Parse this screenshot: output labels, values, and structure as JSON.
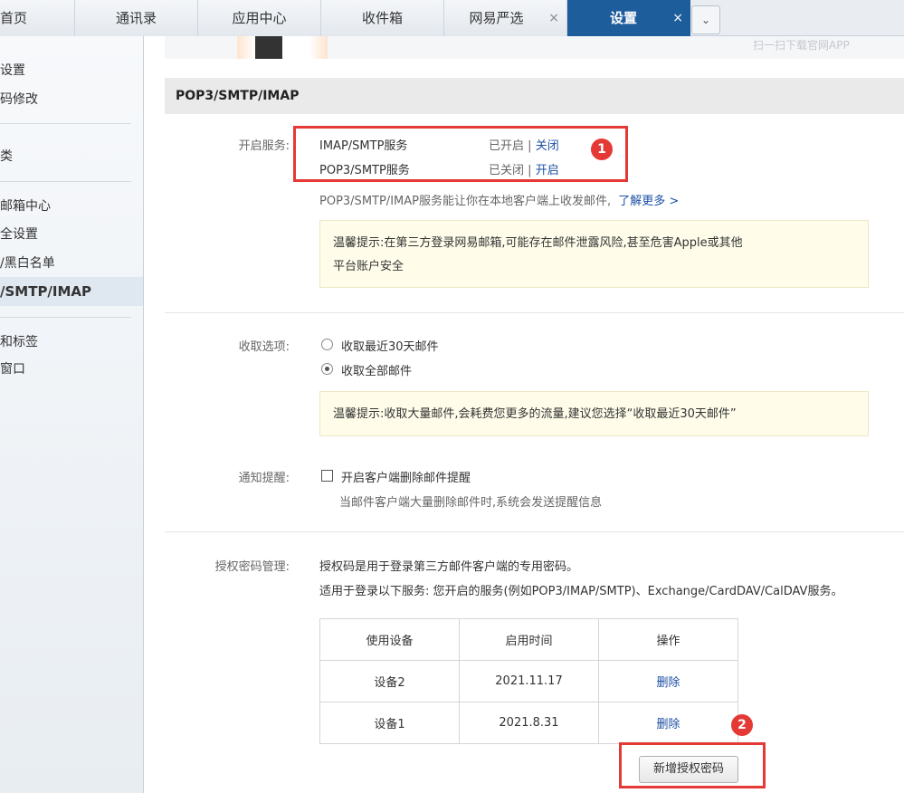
{
  "tabs": [
    {
      "label": "首页"
    },
    {
      "label": "通讯录"
    },
    {
      "label": "应用中心"
    },
    {
      "label": "收件箱"
    },
    {
      "label": "网易严选",
      "close": "×"
    },
    {
      "label": "设置",
      "close": "×"
    }
  ],
  "tab_dropdown": "⌄",
  "sidebar": {
    "items": [
      {
        "label": "设置"
      },
      {
        "label": "码修改"
      },
      {
        "label": "类"
      },
      {
        "label": "邮箱中心"
      },
      {
        "label": "全设置"
      },
      {
        "label": "/黑白名单"
      },
      {
        "label": "/SMTP/IMAP"
      },
      {
        "label": "和标签"
      },
      {
        "label": "窗口"
      }
    ]
  },
  "top_banner": {
    "qr_text": "扫一扫下载官网APP"
  },
  "section_title": "POP3/SMTP/IMAP",
  "services": {
    "label": "开启服务:",
    "rows": [
      {
        "name": "IMAP/SMTP服务",
        "status": "已开启",
        "sep": "|",
        "action": "关闭"
      },
      {
        "name": "POP3/SMTP服务",
        "status": "已关闭",
        "sep": "|",
        "action": "开启"
      }
    ],
    "desc": "POP3/SMTP/IMAP服务能让你在本地客户端上收发邮件,",
    "learn_more": "了解更多 >",
    "tip_line1": "温馨提示:在第三方登录网易邮箱,可能存在邮件泄露风险,甚至危害Apple或其他",
    "tip_line2": "平台账户安全"
  },
  "badges": {
    "one": "1",
    "two": "2"
  },
  "receive": {
    "label": "收取选项:",
    "options": [
      {
        "label": "收取最近30天邮件",
        "selected": false
      },
      {
        "label": "收取全部邮件",
        "selected": true
      }
    ],
    "tip": "温馨提示:收取大量邮件,会耗费您更多的流量,建议您选择“收取最近30天邮件”"
  },
  "notify": {
    "label": "通知提醒:",
    "checkbox_label": "开启客户端删除邮件提醒",
    "hint": "当邮件客户端大量删除邮件时,系统会发送提醒信息"
  },
  "auth": {
    "label": "授权密码管理:",
    "line1": "授权码是用于登录第三方邮件客户端的专用密码。",
    "line2": "适用于登录以下服务: 您开启的服务(例如POP3/IMAP/SMTP)、Exchange/CardDAV/CalDAV服务。",
    "columns": [
      "使用设备",
      "启用时间",
      "操作"
    ],
    "rows": [
      {
        "device": "设备2",
        "date": "2021.11.17",
        "action": "删除"
      },
      {
        "device": "设备1",
        "date": "2021.8.31",
        "action": "删除"
      }
    ],
    "new_button": "新增授权密码"
  },
  "colors": {
    "accent": "#1e5d9c",
    "highlight": "#e53935",
    "tip_bg": "#fffdea"
  }
}
